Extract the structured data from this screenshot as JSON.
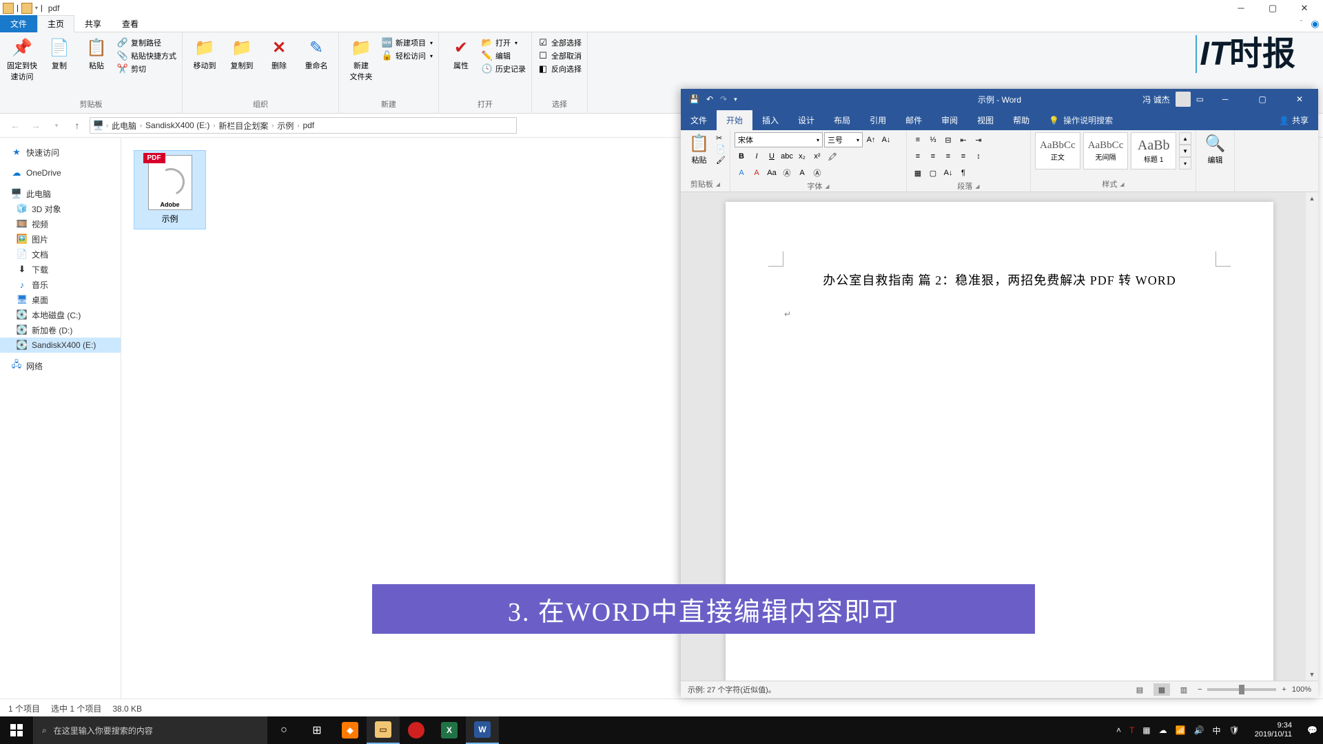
{
  "explorer": {
    "title": "pdf",
    "tabs": {
      "file": "文件",
      "home": "主页",
      "share": "共享",
      "view": "查看"
    },
    "ribbon": {
      "pin": "固定到快\n速访问",
      "copy": "复制",
      "paste": "粘贴",
      "copy_path": "复制路径",
      "paste_shortcut": "粘贴快捷方式",
      "cut": "剪切",
      "clip_group": "剪贴板",
      "move_to": "移动到",
      "copy_to": "复制到",
      "delete": "删除",
      "rename": "重命名",
      "org_group": "组织",
      "new_folder": "新建\n文件夹",
      "new_item": "新建项目",
      "easy_access": "轻松访问",
      "new_group": "新建",
      "properties": "属性",
      "open": "打开",
      "edit": "编辑",
      "history": "历史记录",
      "open_group": "打开",
      "select_all": "全部选择",
      "select_none": "全部取消",
      "invert": "反向选择",
      "select_group": "选择"
    },
    "breadcrumbs": [
      "此电脑",
      "SandiskX400 (E:)",
      "新栏目企划案",
      "示例",
      "pdf"
    ],
    "nav": {
      "quick": "快速访问",
      "onedrive": "OneDrive",
      "thispc": "此电脑",
      "objects3d": "3D 对象",
      "videos": "视频",
      "pictures": "图片",
      "documents": "文档",
      "downloads": "下载",
      "music": "音乐",
      "desktop": "桌面",
      "diskc": "本地磁盘 (C:)",
      "diskd": "新加卷 (D:)",
      "diske": "SandiskX400 (E:)",
      "network": "网络"
    },
    "file": {
      "name": "示例",
      "badge": "PDF",
      "brand": "Adobe"
    },
    "status": {
      "count": "1 个项目",
      "selected": "选中 1 个项目",
      "size": "38.0 KB"
    }
  },
  "word": {
    "title": "示例 - Word",
    "user": "冯 诚杰",
    "tabs": {
      "file": "文件",
      "home": "开始",
      "insert": "插入",
      "design": "设计",
      "layout": "布局",
      "references": "引用",
      "mailings": "邮件",
      "review": "审阅",
      "view": "视图",
      "help": "帮助",
      "tell": "操作说明搜索",
      "share": "共享"
    },
    "ribbon": {
      "paste": "粘贴",
      "clip_group": "剪贴板",
      "font_name": "宋体",
      "font_size": "三号",
      "font_group": "字体",
      "para_group": "段落",
      "style1": "正文",
      "style2": "无间隔",
      "style3": "标题 1",
      "style_preview": "AaBbCc",
      "style_preview_big": "AaBb",
      "styles_group": "样式",
      "edit": "编辑"
    },
    "document": {
      "heading": "办公室自救指南 篇 2：稳准狠，两招免费解决 PDF 转 WORD"
    },
    "status": {
      "left": "示例: 27 个字符(近似值)。",
      "zoom": "100%"
    }
  },
  "caption": "3. 在WORD中直接编辑内容即可",
  "watermark": {
    "it": "IT",
    "cn": "时报"
  },
  "taskbar": {
    "search": "在这里输入你要搜索的内容",
    "time": "9:34",
    "date": "2019/10/11"
  }
}
